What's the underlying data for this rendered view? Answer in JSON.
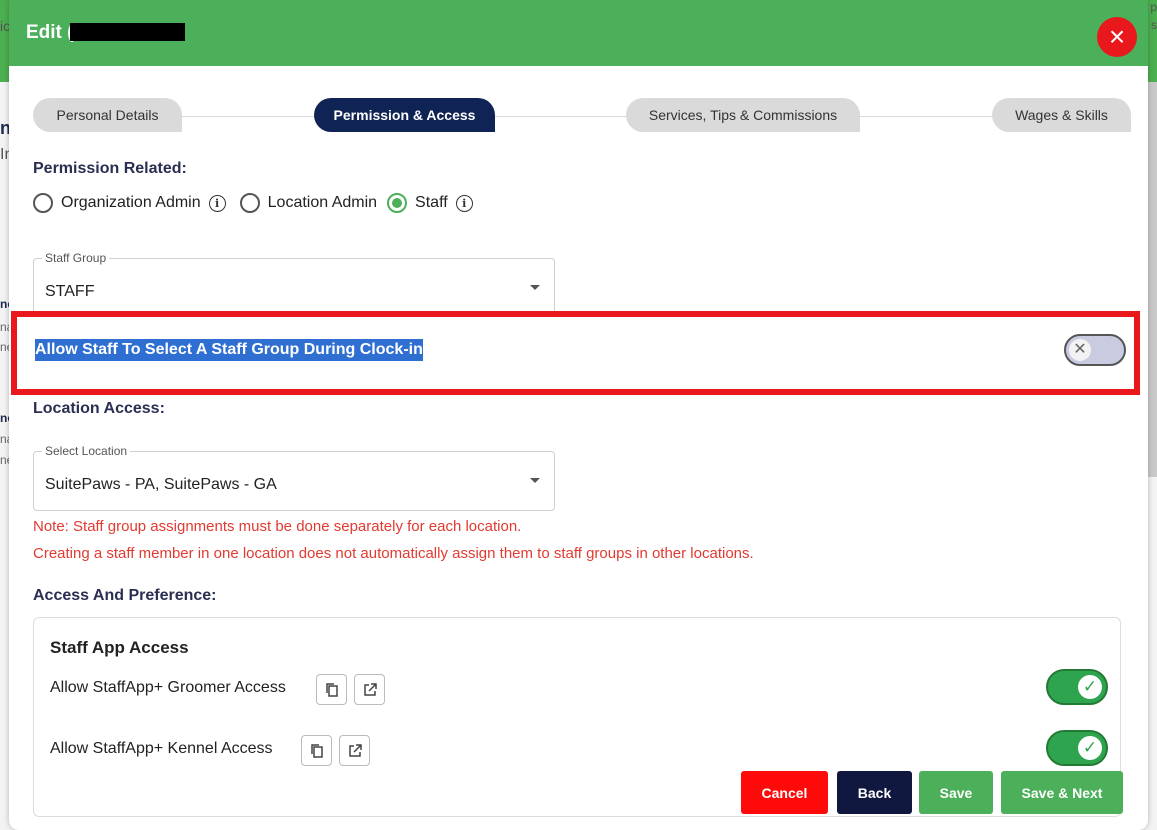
{
  "background": {
    "fragments": [
      "ic",
      "n",
      "In",
      "ne",
      "na",
      "ne",
      "ne",
      "na",
      "ne",
      "p",
      "s"
    ]
  },
  "modal": {
    "title": "Edit (",
    "close_icon": "×"
  },
  "tabs": [
    {
      "label": "Personal Details",
      "active": false
    },
    {
      "label": "Permission & Access",
      "active": true
    },
    {
      "label": "Services, Tips & Commissions",
      "active": false
    },
    {
      "label": "Wages & Skills",
      "active": false
    }
  ],
  "permission": {
    "heading": "Permission Related:",
    "options": [
      {
        "label": "Organization Admin",
        "selected": false,
        "info": true
      },
      {
        "label": "Location Admin",
        "selected": false,
        "info": false
      },
      {
        "label": "Staff",
        "selected": true,
        "info": true
      }
    ],
    "info_glyph": "i"
  },
  "staff_group": {
    "legend": "Staff Group",
    "value": "STAFF"
  },
  "clock_in": {
    "label": "Allow Staff To Select A Staff Group During Clock-in",
    "enabled": false,
    "knob_glyph": "✕"
  },
  "location": {
    "heading": "Location Access:",
    "legend": "Select Location",
    "value": "SuitePaws - PA, SuitePaws - GA",
    "note1": "Note: Staff group assignments must be done separately for each location.",
    "note2": "Creating a staff member in one location does not automatically assign them to staff groups in other locations."
  },
  "access": {
    "heading": "Access And Preference:",
    "card_title": "Staff App Access",
    "items": [
      {
        "label": "Allow StaffApp+ Groomer Access",
        "enabled": true
      },
      {
        "label": "Allow StaffApp+ Kennel Access",
        "enabled": true
      }
    ],
    "check_glyph": "✓"
  },
  "footer": {
    "cancel": "Cancel",
    "back": "Back",
    "save": "Save",
    "save_next": "Save & Next"
  },
  "colors": {
    "header_green": "#4caf5a",
    "active_tab_navy": "#0f2455",
    "danger_red": "#e8181c",
    "selection_blue": "#2f6fd1"
  }
}
